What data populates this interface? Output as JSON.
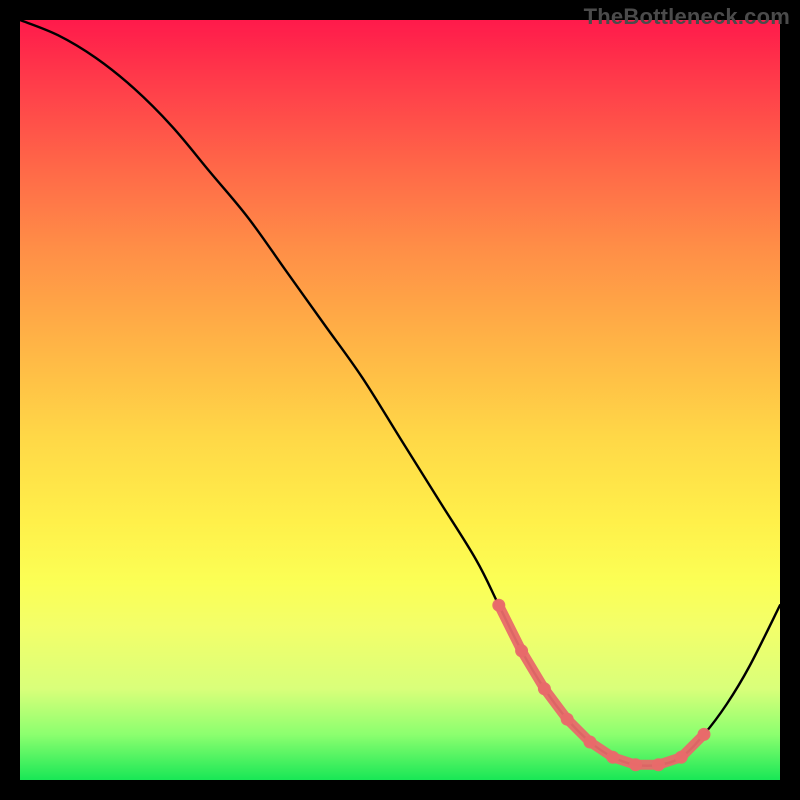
{
  "watermark": "TheBottleneck.com",
  "colors": {
    "marker": "#e86a6a",
    "curve": "#000000",
    "frame": "#000000"
  },
  "chart_data": {
    "type": "line",
    "title": "",
    "xlabel": "",
    "ylabel": "",
    "xlim": [
      0,
      100
    ],
    "ylim": [
      0,
      100
    ],
    "grid": false,
    "legend": false,
    "series": [
      {
        "name": "bottleneck-curve",
        "x": [
          0,
          5,
          10,
          15,
          20,
          25,
          30,
          35,
          40,
          45,
          50,
          55,
          60,
          63,
          66,
          69,
          72,
          75,
          78,
          81,
          84,
          87,
          90,
          93,
          96,
          100
        ],
        "values": [
          100,
          98,
          95,
          91,
          86,
          80,
          74,
          67,
          60,
          53,
          45,
          37,
          29,
          23,
          17,
          12,
          8,
          5,
          3,
          2,
          2,
          3,
          6,
          10,
          15,
          23
        ]
      }
    ],
    "highlight": {
      "name": "minimum-plateau",
      "x": [
        63,
        66,
        69,
        72,
        75,
        78,
        81,
        84,
        87,
        90
      ],
      "values": [
        23,
        17,
        12,
        8,
        5,
        3,
        2,
        2,
        3,
        6
      ]
    }
  }
}
